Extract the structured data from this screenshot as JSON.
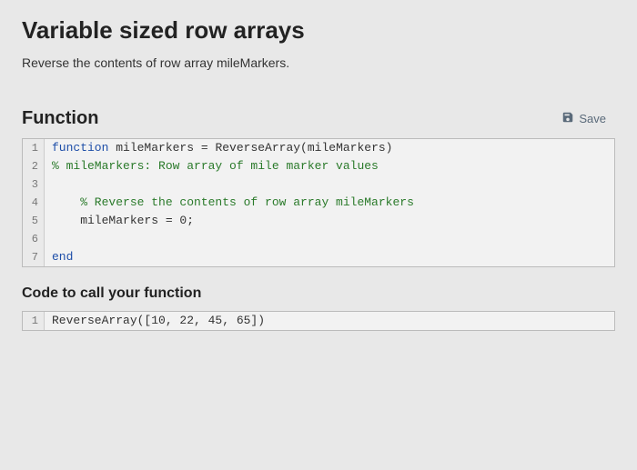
{
  "title": "Variable sized row arrays",
  "instruction": "Reverse the contents of row array mileMarkers.",
  "function_label": "Function",
  "save_label": "Save",
  "code_lines": {
    "l1_kw": "function",
    "l1_rest": " mileMarkers = ReverseArray(mileMarkers)",
    "l2_cmt": "% mileMarkers: Row array of mile marker values",
    "l3": "",
    "l4_cmt": "    % Reverse the contents of row array mileMarkers",
    "l5": "    mileMarkers = 0;",
    "l6": "",
    "l7_kw": "end"
  },
  "linenos": {
    "n1": "1",
    "n2": "2",
    "n3": "3",
    "n4": "4",
    "n5": "5",
    "n6": "6",
    "n7": "7"
  },
  "call_label": "Code to call your function",
  "call_lines": {
    "l1": "ReverseArray([10, 22, 45, 65])"
  },
  "call_lineno": {
    "n1": "1"
  }
}
